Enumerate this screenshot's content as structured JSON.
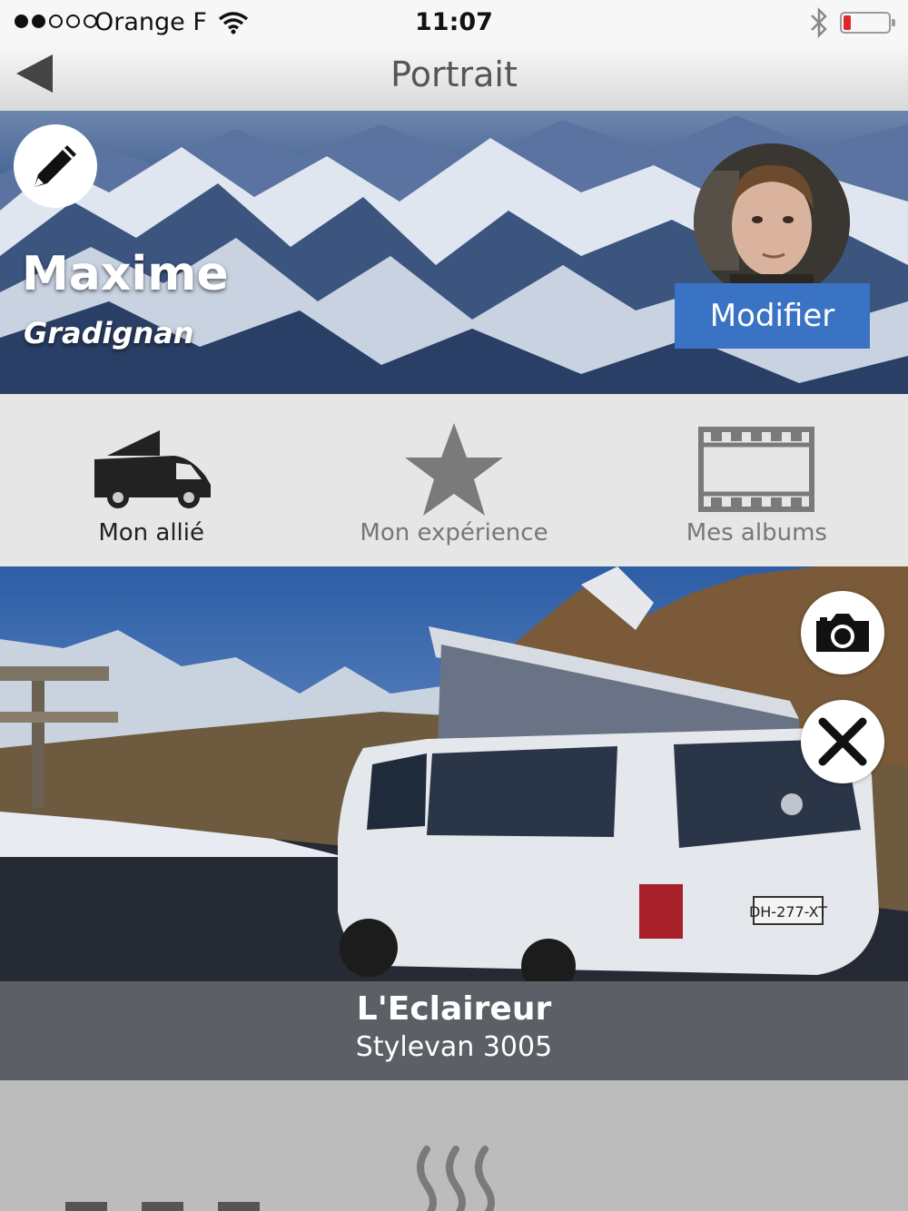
{
  "status": {
    "carrier": "Orange F",
    "time": "11:07"
  },
  "nav": {
    "title": "Portrait"
  },
  "profile": {
    "name": "Maxime",
    "city": "Gradignan",
    "modify_label": "Modifier"
  },
  "tabs": [
    {
      "label": "Mon allié",
      "icon": "van-icon",
      "active": true
    },
    {
      "label": "Mon expérience",
      "icon": "star-icon",
      "active": false
    },
    {
      "label": "Mes albums",
      "icon": "film-icon",
      "active": false
    }
  ],
  "vehicle": {
    "name": "L'Eclaireur",
    "model": "Stylevan 3005",
    "plate": "DH-277-XT"
  },
  "colors": {
    "accent": "#3a73c3",
    "caption_bg": "#5c5f66",
    "battery": "#e0262b"
  }
}
